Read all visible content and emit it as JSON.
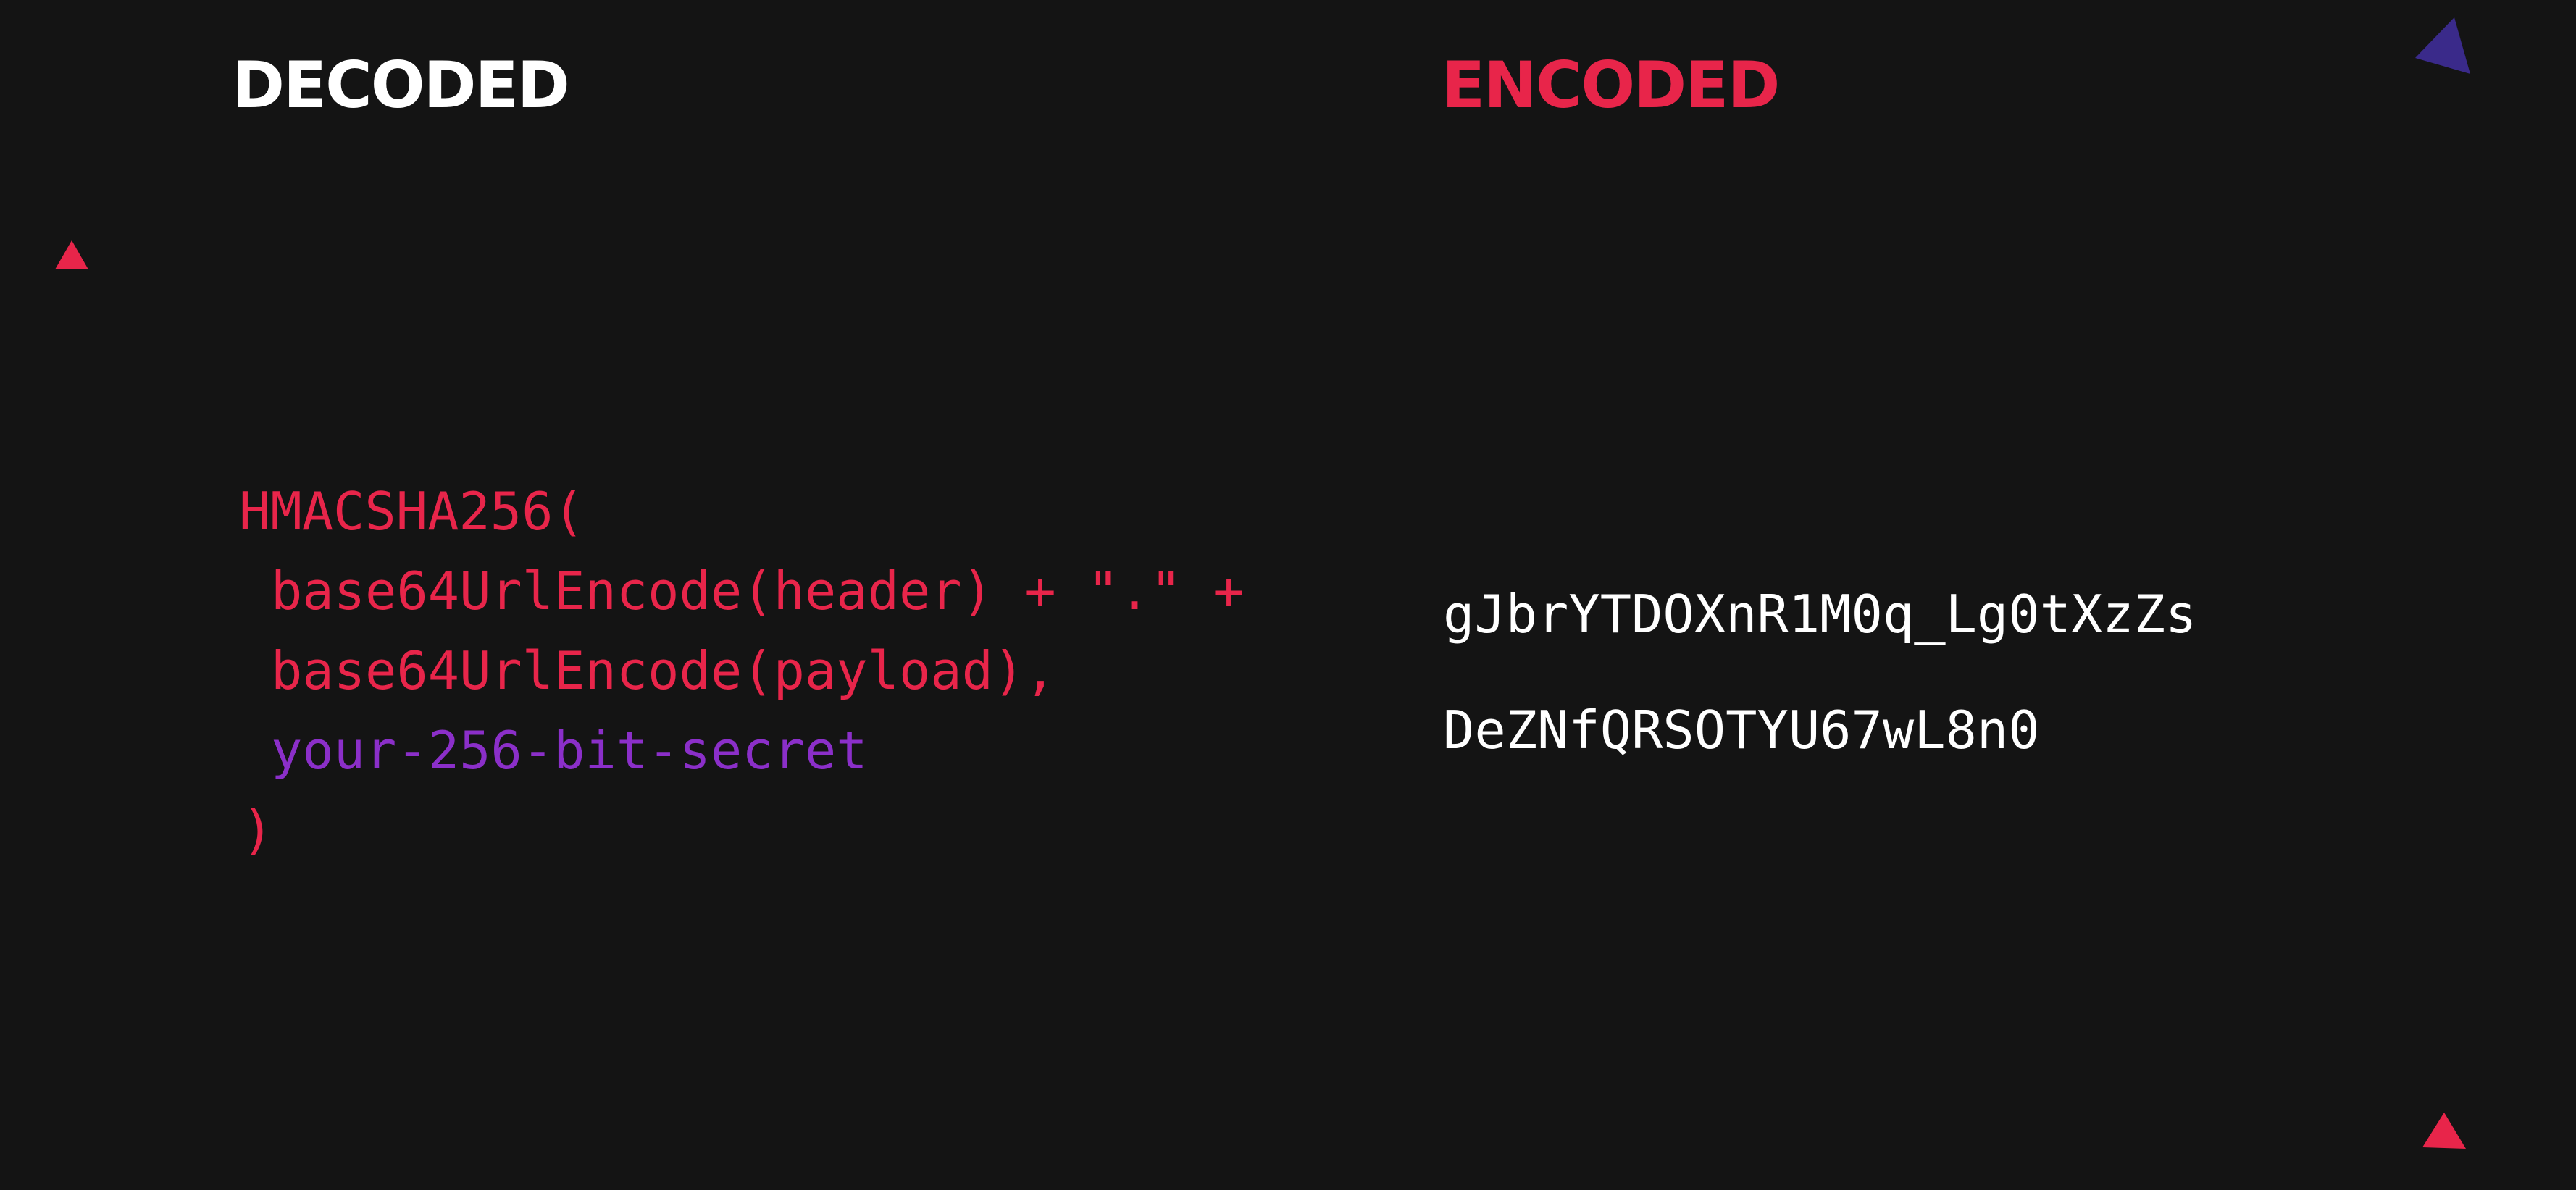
{
  "colors": {
    "background": "#141414",
    "heading_decoded": "#ffffff",
    "heading_encoded": "#e8254a",
    "code_function": "#e8254a",
    "code_secret": "#8b2fc9",
    "encoded_text": "#ffffff",
    "triangle_red": "#e8254a",
    "triangle_purple": "#3a2a8a"
  },
  "headings": {
    "decoded": "DECODED",
    "encoded": "ENCODED"
  },
  "decoded": {
    "open": "HMACSHA256(",
    "line1": "base64UrlEncode(header) + \".\" +",
    "line2": "base64UrlEncode(payload),",
    "secret": "your-256-bit-secret",
    "close": ")"
  },
  "encoded": {
    "line1": "gJbrYTDOXnR1M0q_Lg0tXzZs",
    "line2": "DeZNfQRSOTYU67wL8n0"
  },
  "decorations": [
    "triangle-red",
    "triangle-red",
    "triangle-purple",
    "triangle-red"
  ]
}
